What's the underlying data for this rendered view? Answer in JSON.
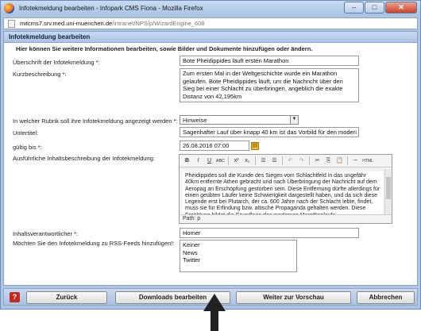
{
  "window": {
    "title": "Infotekmeldung bearbeiten - Infopark CMS Fiona - Mozilla Firefox",
    "controls": [
      "–",
      "□",
      "✕"
    ]
  },
  "address": {
    "host": "mitcms7.srv.med.uni-muenchen.de",
    "path": "/intranet/NPS/p/WizardEngine_608"
  },
  "form": {
    "header": "Infotekmeldung bearbeiten",
    "info": "Hier können Sie weitere Informationen bearbeiten, sowie Bilder und Dokumente hinzufügen oder ändern.",
    "fields": {
      "headline_label": "Überschrift der Infotekmeldung *:",
      "headline_value": "Bote Pheidippides läuft ersten Marathon",
      "summary_label": "Kurzbeschreibung *:",
      "summary_value": "Zum ersten Mal in der Weltgeschichte wurde ein Marathon gelaufen. Bote Pheidippides läuft, um die Nachricht über den Sieg bei einer Schlacht zu überbringen, angeblich die exakte Distanz von 42,195km",
      "category_label": "In welcher Rubrik soll ihre Infotekmeldung angezeigt werden *:",
      "category_value": "Hinweise",
      "subtitle_label": "Untertitel:",
      "subtitle_value": "Sagenhafter Lauf über knapp 40 km ist das Vorbild für den moderi",
      "valid_label": "gültig bis *:",
      "valid_value": "26.08.2016 07:00",
      "description_label": "Ausführliche Inhaltsbeschreibung der Infotekmeldung:",
      "description_value": "Pheidippides soll die Kunde des Sieges vom Schlachtfeld in das ungefähr 40km entfernte Athen gebracht und nach Überbringung der Nachricht auf dem Aeropag an Erschöpfung gestorben sein. Diese Entfernung dürfte allerdings für einen geübten Läufer keine Schwierigkeit dargestellt haben, und da sich diese Legende erst bei Plutarch, der ca. 600 Jahre nach der Schlacht lebte, findet, muss sie für Erfindung bzw. attische Propaganda gehalten werden. Diese Erzählung bildet die Grundlage des modernen Marathonlaufs.",
      "editor_path": "Path: p",
      "responsible_label": "Inhaltsverantwortlicher *:",
      "responsible_value": "Homer",
      "rss_label": "Möchten Sie den Infotekmeldung zu RSS-Feeds hinzufügen!:",
      "rss_options": [
        "Keiner",
        "News",
        "Twitter"
      ]
    }
  },
  "toolbar_buttons": [
    "B",
    "I",
    "U",
    "ABC",
    "x²",
    "x₂",
    "☰",
    "☰",
    "↶",
    "↷",
    "✂",
    "⎘",
    "📋",
    "─",
    "HTML"
  ],
  "buttons": {
    "help": "?",
    "back": "Zurück",
    "downloads": "Downloads bearbeiten",
    "next": "Weiter zur Vorschau",
    "cancel": "Abbrechen"
  }
}
